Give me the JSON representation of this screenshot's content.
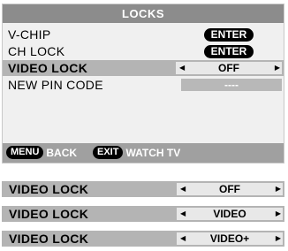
{
  "menu": {
    "title": "LOCKS",
    "rows": [
      {
        "label": "V-CHIP",
        "action": "ENTER"
      },
      {
        "label": "CH LOCK",
        "action": "ENTER"
      },
      {
        "label": "VIDEO LOCK",
        "value": "OFF"
      },
      {
        "label": "NEW PIN CODE",
        "value": "----"
      }
    ]
  },
  "footer": {
    "back_key": "MENU",
    "back_label": "BACK",
    "exit_key": "EXIT",
    "exit_label": "WATCH TV"
  },
  "video_lock_options": [
    {
      "label": "VIDEO LOCK",
      "value": "OFF"
    },
    {
      "label": "VIDEO LOCK",
      "value": "VIDEO"
    },
    {
      "label": "VIDEO LOCK",
      "value": "VIDEO+"
    }
  ],
  "colors": {
    "title_bar": "#8c8c8c",
    "selected_row": "#b4b4b4",
    "footer_bar": "#a0a0a0",
    "pill": "#000000"
  }
}
